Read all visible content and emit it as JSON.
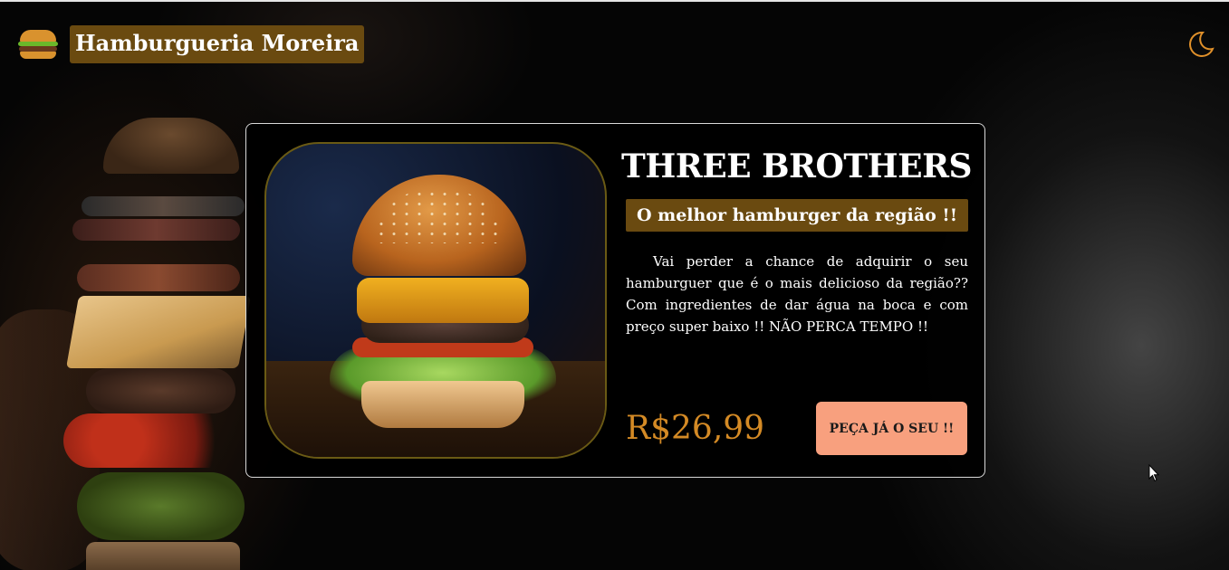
{
  "header": {
    "brand_name": "Hamburgueria Moreira",
    "logo_icon": "burger-icon",
    "theme_toggle_icon": "moon-icon"
  },
  "product": {
    "name": "THREE BROTHERS",
    "tagline": "O melhor hamburger da região !!",
    "description": "Vai perder a chance de adquirir o seu hamburguer que é o mais delicioso da região?? Com ingredientes de dar água na boca e com preço super baixo !! NÃO PERCA TEMPO !!",
    "price": "R$26,99",
    "order_button_label": "PEÇA JÁ O SEU !!",
    "image_icon": "burger-photo"
  },
  "colors": {
    "accent_gold": "#6a4a10",
    "price_orange": "#d48a25",
    "button_salmon": "#f8a07e",
    "moon_orange": "#e0902a"
  }
}
